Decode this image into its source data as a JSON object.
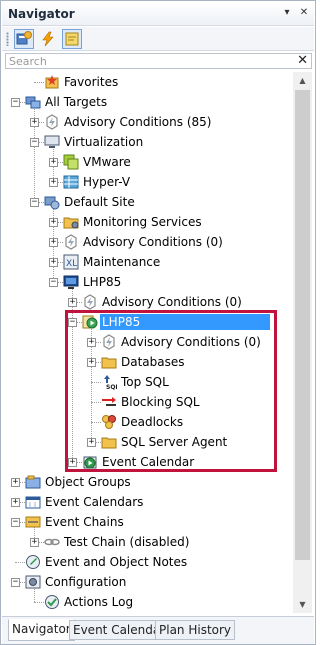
{
  "panel": {
    "title": "Navigator",
    "pin_symbol": "▾",
    "close_symbol": "✕"
  },
  "toolbar": {
    "buttons": [
      {
        "name": "add-targets-button",
        "icon": "add-icon"
      },
      {
        "name": "quick-action-button",
        "icon": "lightning-icon"
      },
      {
        "name": "notes-button",
        "icon": "note-icon"
      }
    ]
  },
  "search": {
    "placeholder": "Search",
    "clear_symbol": "✕"
  },
  "tree": {
    "items": [
      {
        "label": "Favorites",
        "icon": "favorites-icon",
        "expandable": false
      },
      {
        "label": "All Targets",
        "icon": "targets-icon",
        "expandable": true,
        "expanded": true
      },
      {
        "label": "Advisory Conditions (85)",
        "icon": "advisory-icon",
        "expandable": true,
        "expanded": false
      },
      {
        "label": "Virtualization",
        "icon": "virtualization-icon",
        "expandable": true,
        "expanded": true
      },
      {
        "label": "VMware",
        "icon": "vmware-icon",
        "expandable": true,
        "expanded": false
      },
      {
        "label": "Hyper-V",
        "icon": "hyperv-icon",
        "expandable": true,
        "expanded": false
      },
      {
        "label": "Default Site",
        "icon": "site-icon",
        "expandable": true,
        "expanded": true
      },
      {
        "label": "Monitoring Services",
        "icon": "folder-gear-icon",
        "expandable": true,
        "expanded": false
      },
      {
        "label": "Advisory Conditions (0)",
        "icon": "advisory-icon",
        "expandable": true,
        "expanded": false
      },
      {
        "label": "Maintenance",
        "icon": "maintenance-icon",
        "expandable": true,
        "expanded": false
      },
      {
        "label": "LHP85",
        "icon": "computer-icon",
        "expandable": true,
        "expanded": true
      },
      {
        "label": "Advisory Conditions (0)",
        "icon": "advisory-icon",
        "expandable": true,
        "expanded": false
      },
      {
        "label": "LHP85",
        "icon": "sql-server-icon",
        "expandable": true,
        "expanded": true,
        "selected": true
      },
      {
        "label": "Advisory Conditions (0)",
        "icon": "advisory-icon",
        "expandable": true,
        "expanded": false
      },
      {
        "label": "Databases",
        "icon": "folder-icon",
        "expandable": true,
        "expanded": false
      },
      {
        "label": "Top SQL",
        "icon": "top-sql-icon",
        "expandable": false
      },
      {
        "label": "Blocking SQL",
        "icon": "blocking-sql-icon",
        "expandable": false
      },
      {
        "label": "Deadlocks",
        "icon": "deadlocks-icon",
        "expandable": false
      },
      {
        "label": "SQL Server Agent",
        "icon": "folder-icon",
        "expandable": true,
        "expanded": false
      },
      {
        "label": "Event Calendar",
        "icon": "event-calendar-icon",
        "expandable": true,
        "expanded": false
      },
      {
        "label": "Object Groups",
        "icon": "object-groups-icon",
        "expandable": true,
        "expanded": false
      },
      {
        "label": "Event Calendars",
        "icon": "calendars-icon",
        "expandable": true,
        "expanded": false
      },
      {
        "label": "Event Chains",
        "icon": "event-chains-icon",
        "expandable": true,
        "expanded": true
      },
      {
        "label": "Test Chain (disabled)",
        "icon": "chain-icon",
        "expandable": true,
        "expanded": false
      },
      {
        "label": "Event and Object Notes",
        "icon": "notes-icon",
        "expandable": false
      },
      {
        "label": "Configuration",
        "icon": "configuration-icon",
        "expandable": true,
        "expanded": true
      },
      {
        "label": "Actions Log",
        "icon": "actions-log-icon",
        "expandable": false
      }
    ]
  },
  "tabs": [
    {
      "label": "Navigator",
      "active": true
    },
    {
      "label": "Event Calendar",
      "active": false
    },
    {
      "label": "Plan History",
      "active": false
    }
  ],
  "colors": {
    "selection": "#3399ff",
    "highlight_border": "#c0143c"
  }
}
